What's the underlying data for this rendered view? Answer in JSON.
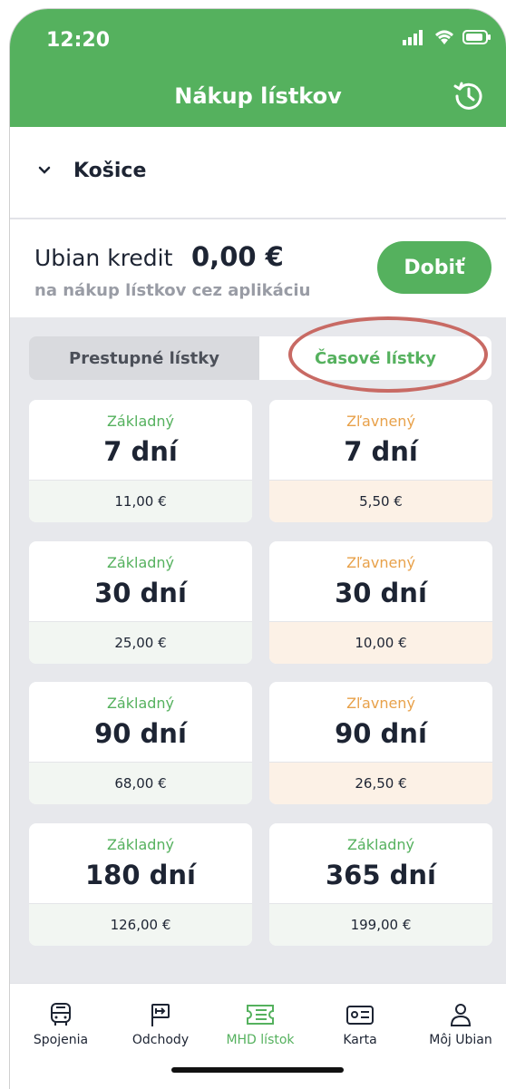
{
  "status": {
    "time": "12:20"
  },
  "header": {
    "title": "Nákup lístkov",
    "history_icon": "history-clock-icon"
  },
  "city": {
    "name": "Košice"
  },
  "credit": {
    "label": "Ubian kredit",
    "amount": "0,00 €",
    "subtitle": "na nákup lístkov cez aplikáciu",
    "button": "Dobiť"
  },
  "tabs": [
    {
      "label": "Prestupné lístky",
      "active": false
    },
    {
      "label": "Časové lístky",
      "active": true
    }
  ],
  "tickets": [
    {
      "type": "Základný",
      "duration": "7 dní",
      "price": "11,00 €"
    },
    {
      "type": "Zľavnený",
      "duration": "7 dní",
      "price": "5,50 €"
    },
    {
      "type": "Základný",
      "duration": "30 dní",
      "price": "25,00 €"
    },
    {
      "type": "Zľavnený",
      "duration": "30 dní",
      "price": "10,00 €"
    },
    {
      "type": "Základný",
      "duration": "90 dní",
      "price": "68,00 €"
    },
    {
      "type": "Zľavnený",
      "duration": "90 dní",
      "price": "26,50 €"
    },
    {
      "type": "Základný",
      "duration": "180 dní",
      "price": "126,00 €"
    },
    {
      "type": "Základný",
      "duration": "365 dní",
      "price": "199,00 €"
    }
  ],
  "nav": [
    {
      "label": "Spojenia",
      "icon": "bus-icon"
    },
    {
      "label": "Odchody",
      "icon": "departures-sign-icon"
    },
    {
      "label": "MHD lístok",
      "icon": "ticket-icon",
      "active": true
    },
    {
      "label": "Karta",
      "icon": "card-icon"
    },
    {
      "label": "Môj Ubian",
      "icon": "user-icon"
    }
  ],
  "colors": {
    "primary": "#55b15e",
    "reduced": "#e8a14a",
    "highlight": "#c86a64"
  }
}
